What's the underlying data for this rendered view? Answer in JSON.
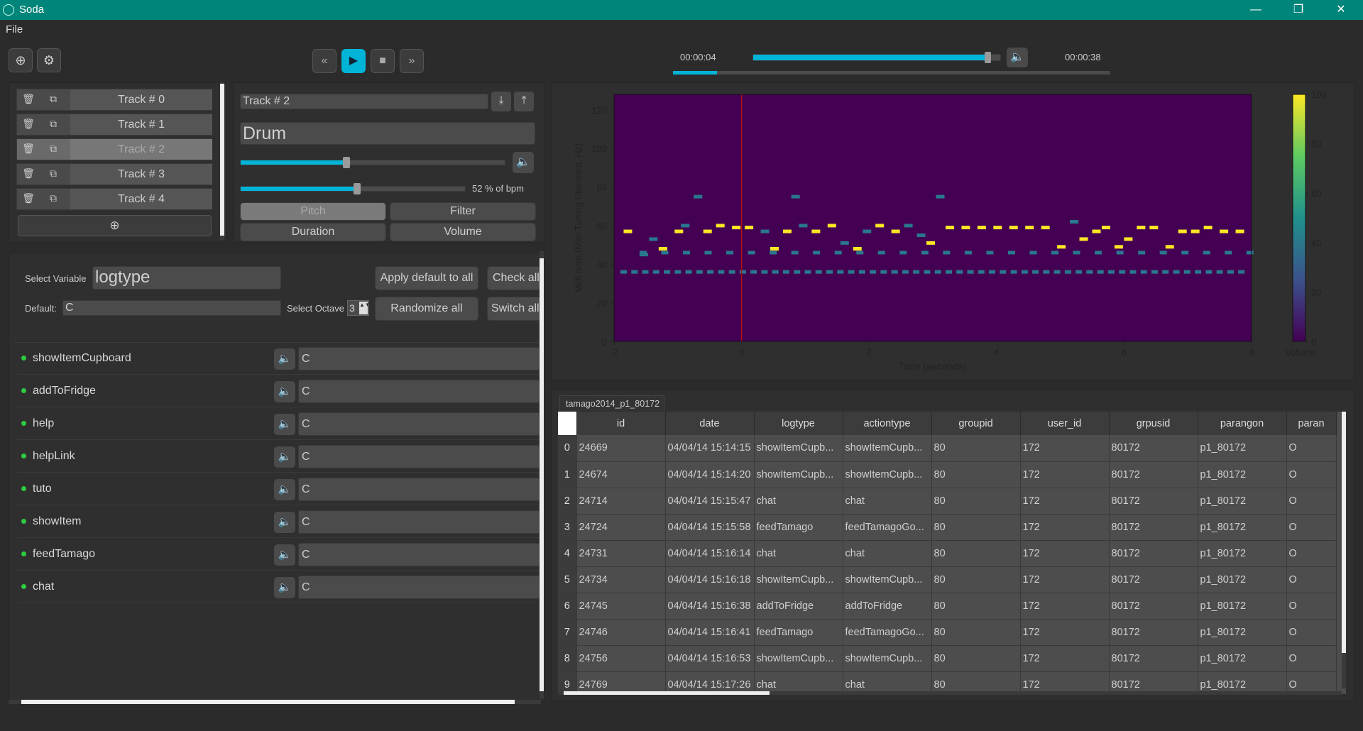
{
  "window": {
    "title": "Soda",
    "minimize": "—",
    "restore": "❐",
    "close": "✕"
  },
  "menu": {
    "file": "File"
  },
  "toolbar": {
    "add_icon": "⊕",
    "settings_icon": "⚙"
  },
  "transport": {
    "rewind": "«",
    "play": "▶",
    "stop": "■",
    "forward": "»"
  },
  "playback": {
    "current_time": "00:00:04",
    "total_time": "00:00:38",
    "progress": 0.95,
    "position_fraction": 0.1
  },
  "tracks": {
    "items": [
      {
        "label": "Track # 0",
        "selected": false
      },
      {
        "label": "Track # 1",
        "selected": false
      },
      {
        "label": "Track # 2",
        "selected": true
      },
      {
        "label": "Track # 3",
        "selected": false
      },
      {
        "label": "Track # 4",
        "selected": false
      }
    ],
    "add_icon": "⊕"
  },
  "track_editor": {
    "name": "Track # 2",
    "instrument": "Drum",
    "volume_fraction": 0.4,
    "bpm_fraction": 0.52,
    "bpm_label": "52 % of bpm",
    "tabs": [
      "Pitch",
      "Filter",
      "Duration",
      "Volume"
    ]
  },
  "variables": {
    "select_label": "Select Variable",
    "selected": "logtype",
    "default_label": "Default:",
    "default_value": "C",
    "octave_label": "Select Octave",
    "octave_value": "3",
    "apply_default": "Apply default to all",
    "check_all": "Check all",
    "randomize_all": "Randomize all",
    "switch_all": "Switch all",
    "rows": [
      {
        "name": "showItemCupboard",
        "note": "C"
      },
      {
        "name": "addToFridge",
        "note": "C"
      },
      {
        "name": "help",
        "note": "C"
      },
      {
        "name": "helpLink",
        "note": "C"
      },
      {
        "name": "tuto",
        "note": "C"
      },
      {
        "name": "showItem",
        "note": "C"
      },
      {
        "name": "feedTamago",
        "note": "C"
      },
      {
        "name": "chat",
        "note": "C"
      }
    ]
  },
  "chart_data": {
    "type": "heatmap",
    "xlabel": "Time (seconds)",
    "ylabel": "Midi note (Midi Tuning Standard, Hz)",
    "xlim": [
      -2,
      8
    ],
    "ylim": [
      0,
      128
    ],
    "xticks": [
      "-2",
      "0",
      "2",
      "4",
      "6",
      "8"
    ],
    "yticks": [
      "0",
      "20",
      "40",
      "60",
      "80",
      "100",
      "120"
    ],
    "colorbar_label": "Volume",
    "colorbar_ticks": [
      "0",
      "20",
      "40",
      "60",
      "80",
      "100"
    ],
    "playhead_x": 0,
    "colors": {
      "background": "#440154",
      "high": "#fde725",
      "mid": "#2a788e",
      "playhead": "#b01010"
    }
  },
  "table": {
    "tab_label": "tamago2014_p1_80172",
    "columns": [
      "id",
      "date",
      "logtype",
      "actiontype",
      "groupid",
      "user_id",
      "grpusid",
      "parangon",
      "paran"
    ],
    "rows": [
      [
        "0",
        "24669",
        "04/04/14 15:14:15",
        "showItemCupb...",
        "showItemCupb...",
        "80",
        "172",
        "80172",
        "p1_80172",
        "O"
      ],
      [
        "1",
        "24674",
        "04/04/14 15:14:20",
        "showItemCupb...",
        "showItemCupb...",
        "80",
        "172",
        "80172",
        "p1_80172",
        "O"
      ],
      [
        "2",
        "24714",
        "04/04/14 15:15:47",
        "chat",
        "chat",
        "80",
        "172",
        "80172",
        "p1_80172",
        "O"
      ],
      [
        "3",
        "24724",
        "04/04/14 15:15:58",
        "feedTamago",
        "feedTamagoGo...",
        "80",
        "172",
        "80172",
        "p1_80172",
        "O"
      ],
      [
        "4",
        "24731",
        "04/04/14 15:16:14",
        "chat",
        "chat",
        "80",
        "172",
        "80172",
        "p1_80172",
        "O"
      ],
      [
        "5",
        "24734",
        "04/04/14 15:16:18",
        "showItemCupb...",
        "showItemCupb...",
        "80",
        "172",
        "80172",
        "p1_80172",
        "O"
      ],
      [
        "6",
        "24745",
        "04/04/14 15:16:38",
        "addToFridge",
        "addToFridge",
        "80",
        "172",
        "80172",
        "p1_80172",
        "O"
      ],
      [
        "7",
        "24746",
        "04/04/14 15:16:41",
        "feedTamago",
        "feedTamagoGo...",
        "80",
        "172",
        "80172",
        "p1_80172",
        "O"
      ],
      [
        "8",
        "24756",
        "04/04/14 15:16:53",
        "showItemCupb...",
        "showItemCupb...",
        "80",
        "172",
        "80172",
        "p1_80172",
        "O"
      ],
      [
        "9",
        "24769",
        "04/04/14 15:17:26",
        "chat",
        "chat",
        "80",
        "172",
        "80172",
        "p1_80172",
        "O"
      ]
    ]
  }
}
